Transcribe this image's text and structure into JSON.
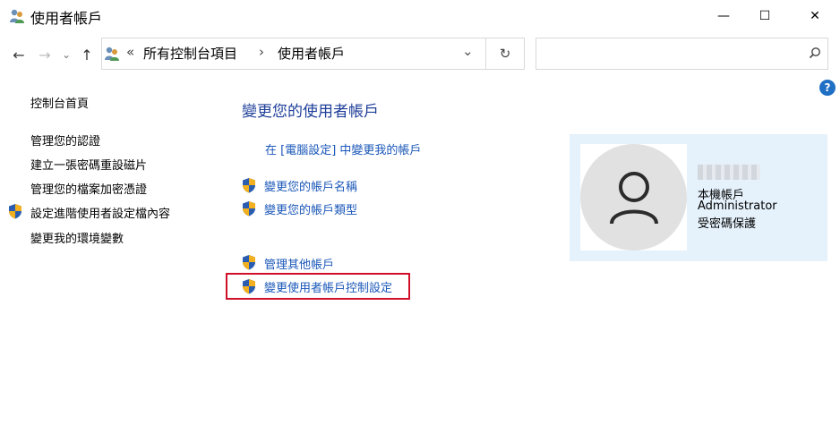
{
  "window": {
    "title": "使用者帳戶",
    "minimize_glyph": "—",
    "maximize_glyph": "☐",
    "close_glyph": "✕"
  },
  "nav": {
    "back_glyph": "←",
    "forward_glyph": "→",
    "history_glyph": "⌄",
    "up_glyph": "↑"
  },
  "address": {
    "overflow": "«",
    "crumbs": [
      "所有控制台項目",
      "使用者帳戶"
    ],
    "separator": "›",
    "dropdown_glyph": "⌄",
    "refresh_glyph": "↻"
  },
  "search": {
    "placeholder": "",
    "icon": "search-icon"
  },
  "help_label": "?",
  "sidebar": {
    "items": [
      {
        "label": "控制台首頁",
        "shield": false
      },
      {
        "label": "管理您的認證",
        "shield": false
      },
      {
        "label": "建立一張密碼重設磁片",
        "shield": false
      },
      {
        "label": "管理您的檔案加密憑證",
        "shield": false
      },
      {
        "label": "設定進階使用者設定檔內容",
        "shield": true
      },
      {
        "label": "變更我的環境變數",
        "shield": false
      }
    ]
  },
  "main": {
    "heading": "變更您的使用者帳戶",
    "links": [
      {
        "label": "在 [電腦設定] 中變更我的帳戶",
        "shield": false
      },
      {
        "label": "變更您的帳戶名稱",
        "shield": true
      },
      {
        "label": "變更您的帳戶類型",
        "shield": true
      },
      {
        "label": "管理其他帳戶",
        "shield": true
      },
      {
        "label": "變更使用者帳戶控制設定",
        "shield": true,
        "highlighted": true
      }
    ]
  },
  "account": {
    "line1": "本機帳戶",
    "line2": "Administrator",
    "line3": "受密碼保護"
  },
  "colors": {
    "accent_link": "#1a57b8",
    "heading": "#1f3f99",
    "highlight_border": "#d0102a",
    "account_panel": "#e5f1fb"
  }
}
